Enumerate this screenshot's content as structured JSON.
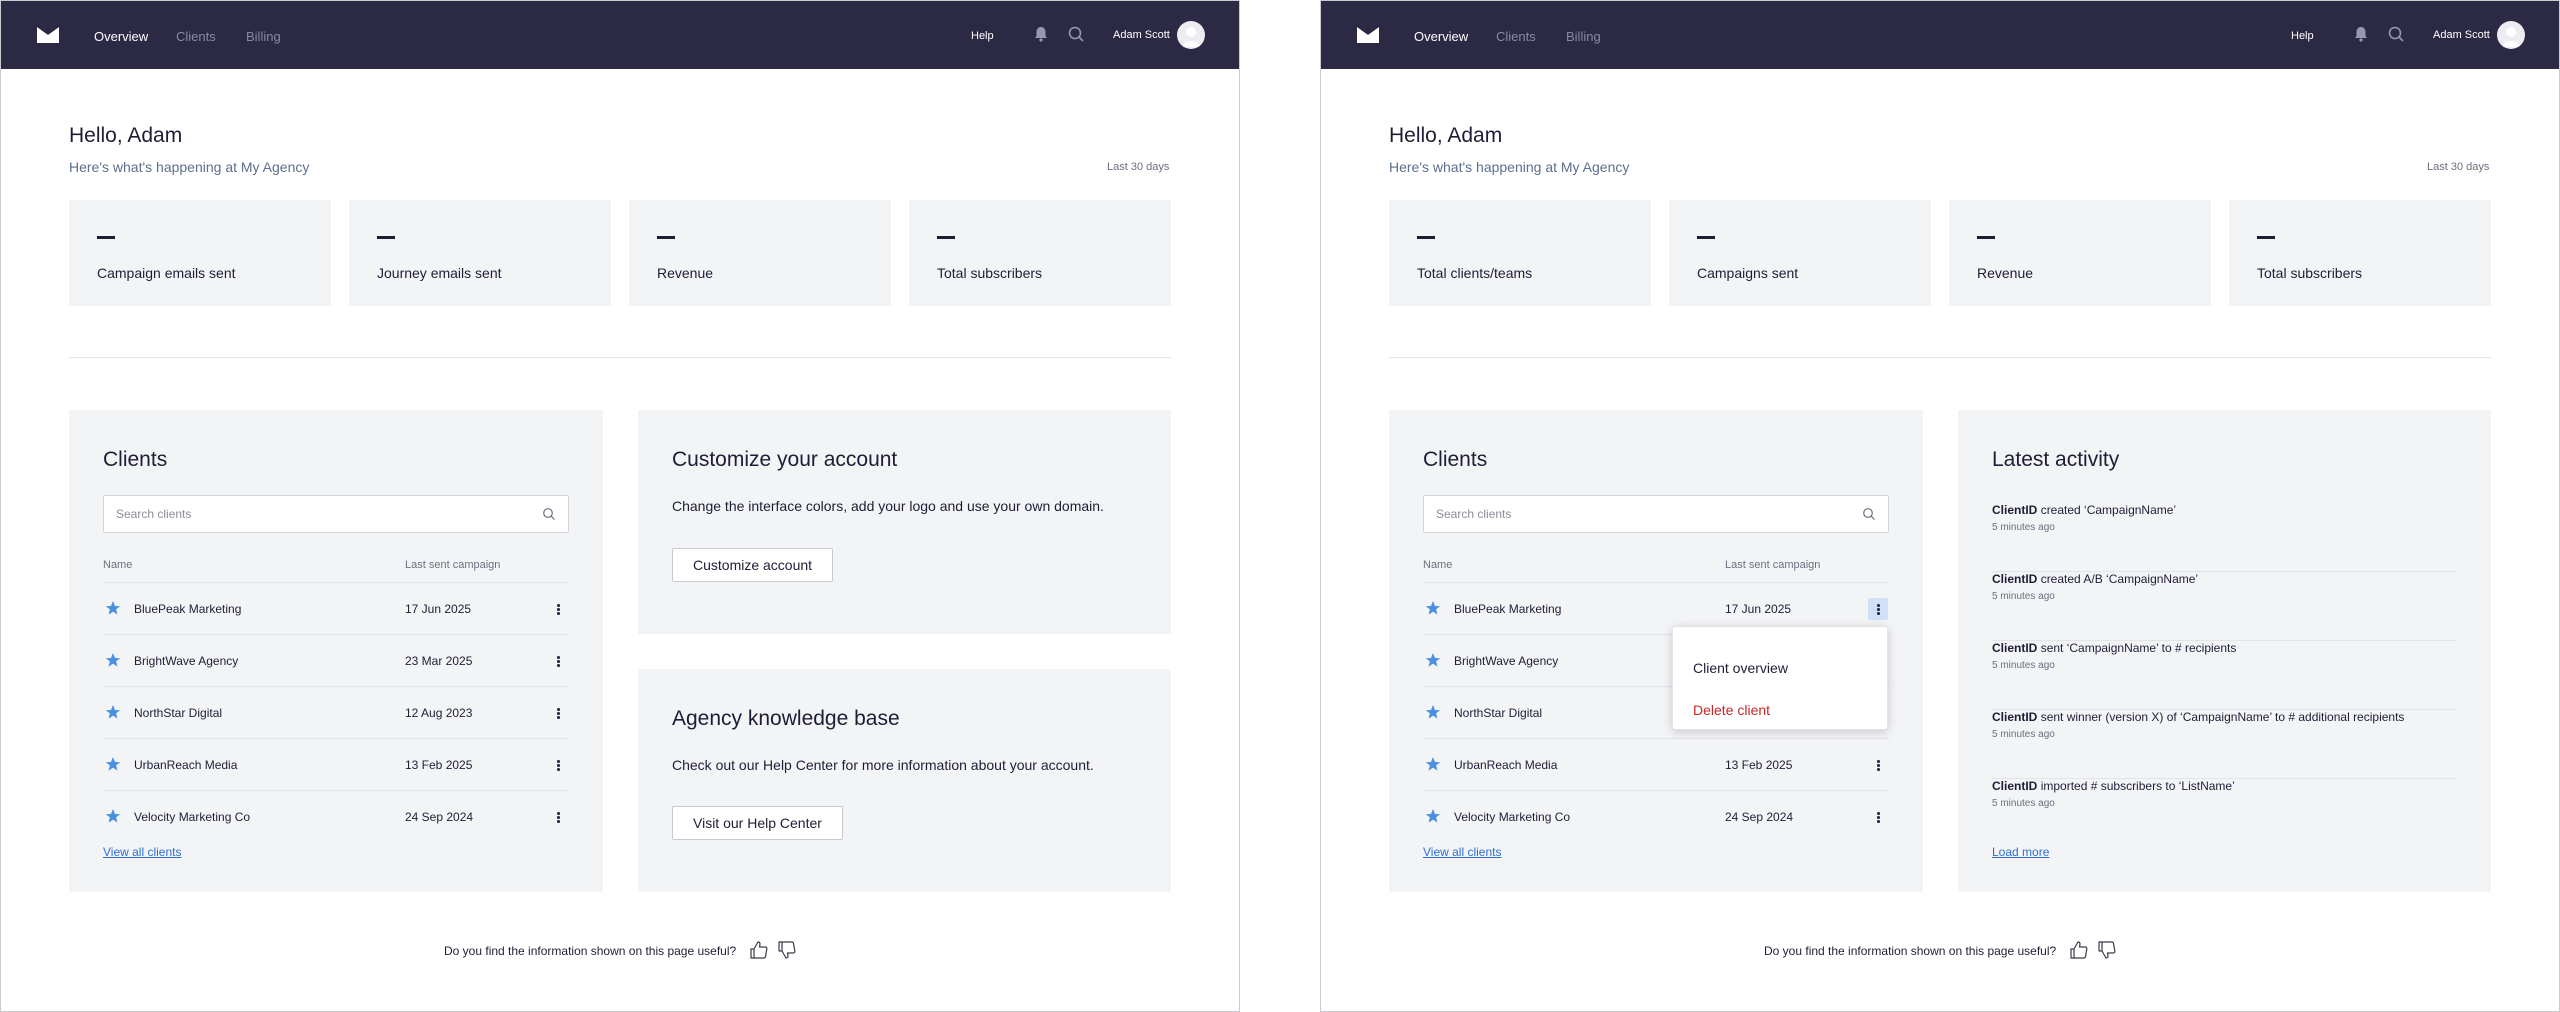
{
  "colors": {
    "nav_bg": "#2b2944",
    "panel_bg": "#f3f4f6",
    "link": "#2f6fd0",
    "danger": "#c62828",
    "star": "#4a8fe0"
  },
  "nav": {
    "items": [
      {
        "label": "Overview"
      },
      {
        "label": "Clients"
      },
      {
        "label": "Billing"
      }
    ],
    "help": "Help",
    "user": "Adam Scott"
  },
  "header": {
    "greeting": "Hello, Adam",
    "subtitle": "Here's what's happening at My Agency",
    "period": "Last 30 days"
  },
  "left": {
    "stats": [
      {
        "value": "–",
        "label": "Campaign emails sent"
      },
      {
        "value": "–",
        "label": "Journey emails sent"
      },
      {
        "value": "–",
        "label": "Revenue"
      },
      {
        "value": "–",
        "label": "Total subscribers"
      }
    ],
    "customize": {
      "title": "Customize your account",
      "text": "Change the interface colors, add your logo and use your own domain.",
      "button": "Customize account"
    },
    "knowledge": {
      "title": "Agency knowledge base",
      "text": "Check out our Help Center for more information about your account.",
      "button": "Visit our Help Center"
    }
  },
  "right": {
    "stats": [
      {
        "value": "–",
        "label": "Total clients/teams"
      },
      {
        "value": "–",
        "label": "Campaigns sent"
      },
      {
        "value": "–",
        "label": "Revenue"
      },
      {
        "value": "–",
        "label": "Total subscribers"
      }
    ],
    "menu": {
      "overview": "Client overview",
      "delete": "Delete client"
    },
    "activity": {
      "title": "Latest activity",
      "items": [
        {
          "actor": "ClientID",
          "text": "created ‘CampaignName’",
          "time": "5 minutes ago"
        },
        {
          "actor": "ClientID",
          "text": "created A/B ‘CampaignName’",
          "time": "5 minutes ago"
        },
        {
          "actor": "ClientID",
          "text": "sent ‘CampaignName’ to # recipients",
          "time": "5 minutes ago"
        },
        {
          "actor": "ClientID",
          "text": "sent winner (version X) of ‘CampaignName’ to # additional recipients",
          "time": "5 minutes ago"
        },
        {
          "actor": "ClientID",
          "text": "imported # subscribers to ‘ListName’",
          "time": "5 minutes ago"
        }
      ],
      "load_more": "Load more"
    }
  },
  "clients": {
    "title": "Clients",
    "search_placeholder": "Search clients",
    "col_name": "Name",
    "col_last": "Last sent campaign",
    "rows": [
      {
        "name": "BluePeak Marketing",
        "date": "17 Jun 2025"
      },
      {
        "name": "BrightWave Agency",
        "date": "23 Mar 2025"
      },
      {
        "name": "NorthStar Digital",
        "date": "12 Aug 2023"
      },
      {
        "name": "UrbanReach Media",
        "date": "13 Feb 2025"
      },
      {
        "name": "Velocity Marketing Co",
        "date": "24 Sep 2024"
      }
    ],
    "view_all": "View all clients"
  },
  "feedback": {
    "question": "Do you find the information shown on this page useful?"
  }
}
